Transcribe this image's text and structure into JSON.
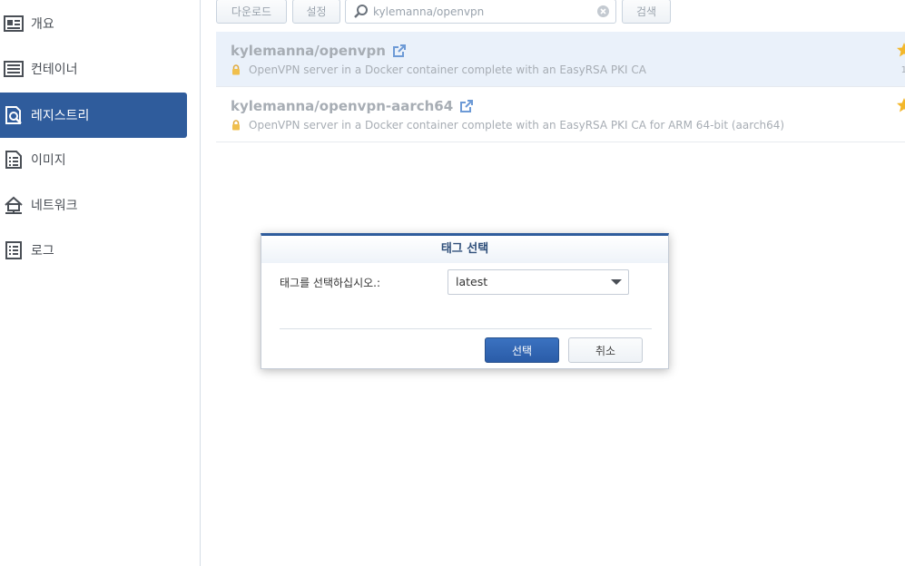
{
  "sidebar": {
    "items": [
      {
        "label": "개요",
        "icon": "overview-icon"
      },
      {
        "label": "컨테이너",
        "icon": "container-icon"
      },
      {
        "label": "레지스트리",
        "icon": "registry-icon",
        "active": true
      },
      {
        "label": "이미지",
        "icon": "image-icon"
      },
      {
        "label": "네트워크",
        "icon": "network-icon"
      },
      {
        "label": "로그",
        "icon": "log-icon"
      }
    ]
  },
  "toolbar": {
    "download_label": "다운로드",
    "settings_label": "설정",
    "search_value": "kylemanna/openvpn",
    "search_button_label": "검색"
  },
  "results": [
    {
      "name": "kylemanna/openvpn",
      "description": "OpenVPN server in a Docker container complete with an EasyRSA PKI CA",
      "stars": "1"
    },
    {
      "name": "kylemanna/openvpn-aarch64",
      "description": "OpenVPN server in a Docker container complete with an EasyRSA PKI CA for ARM 64-bit (aarch64)"
    }
  ],
  "dialog": {
    "title": "태그 선택",
    "label": "태그를 선택하십시오.:",
    "selected_tag": "latest",
    "confirm_label": "선택",
    "cancel_label": "취소"
  },
  "colors": {
    "accent": "#2f5c9c",
    "selected_row": "#eaf1fa",
    "star": "#f3b72b"
  }
}
